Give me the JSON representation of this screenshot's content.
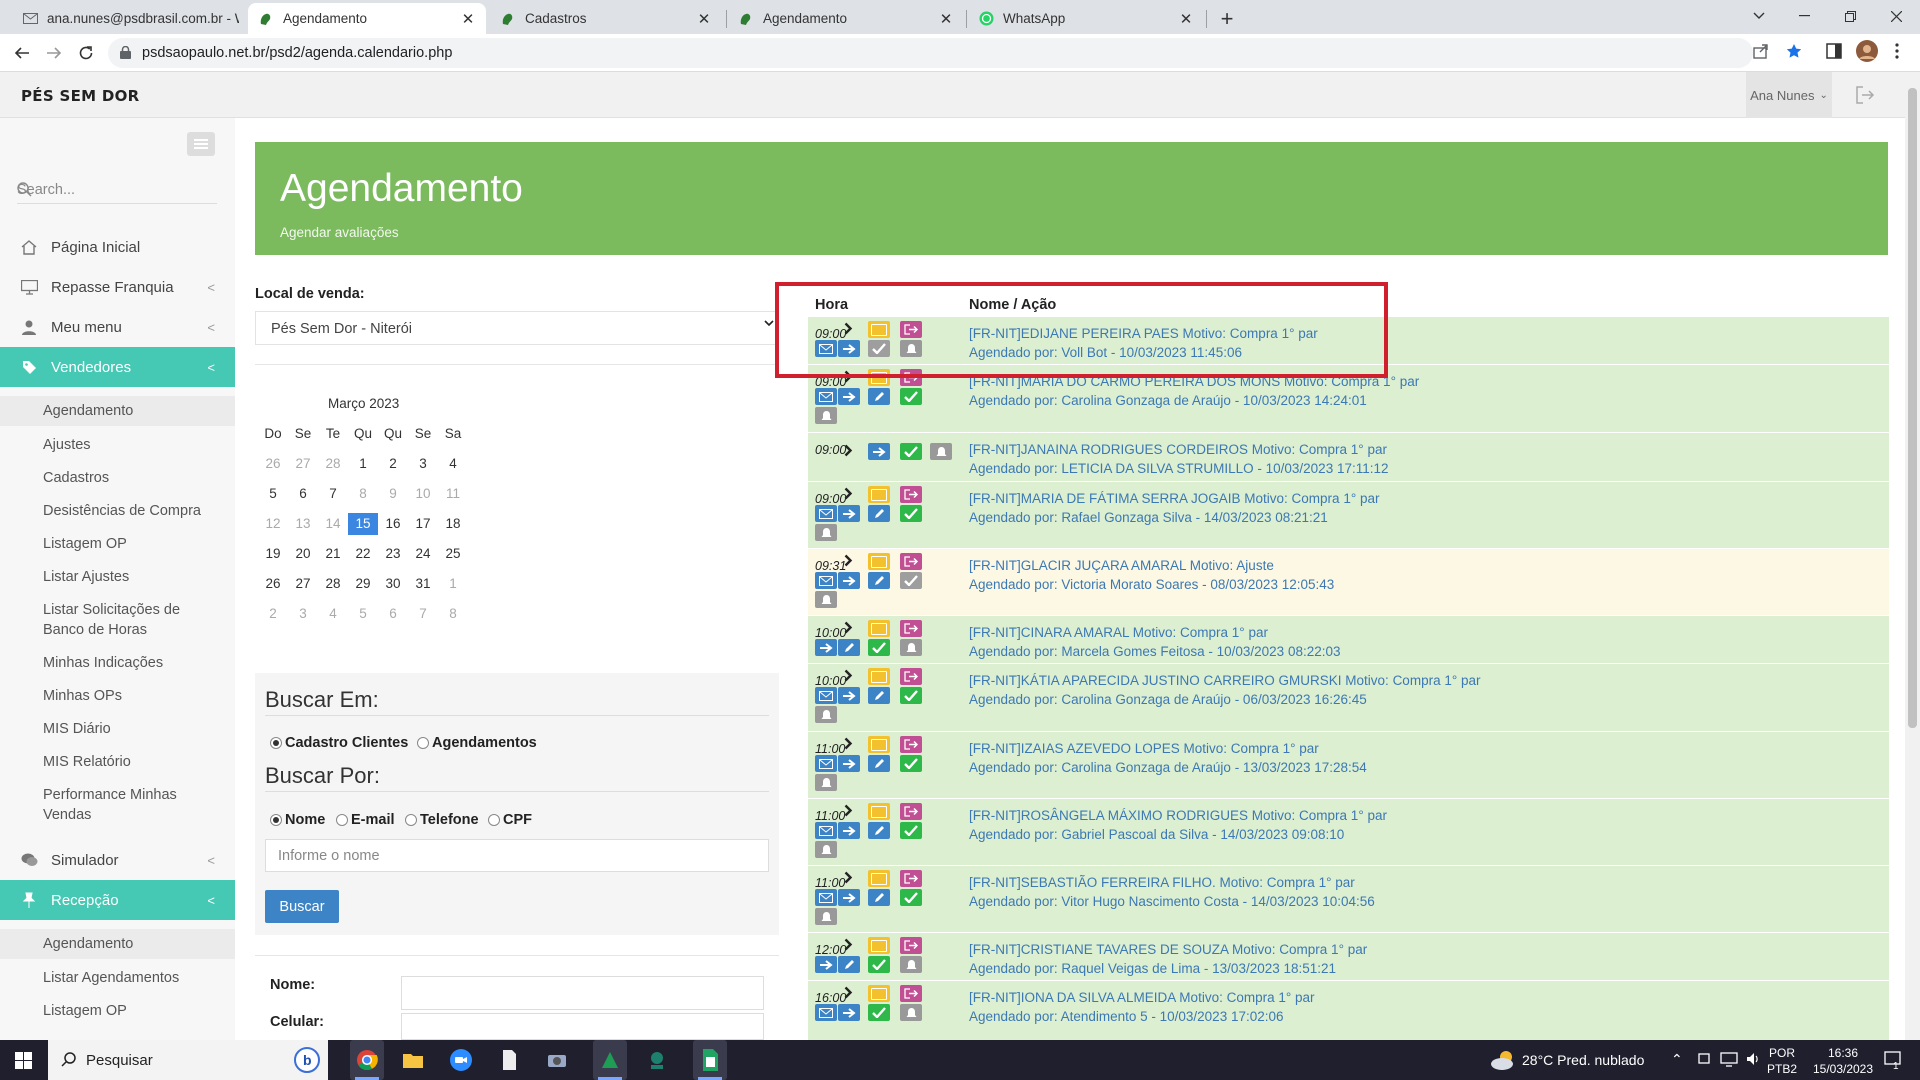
{
  "browser": {
    "tabs": [
      {
        "title": "ana.nunes@psdbrasil.com.br - W",
        "icon": "mail-icon",
        "active": false
      },
      {
        "title": "Agendamento",
        "icon": "foot-logo-icon",
        "active": true
      },
      {
        "title": "Cadastros",
        "icon": "foot-logo-icon",
        "active": false
      },
      {
        "title": "Agendamento",
        "icon": "foot-logo-icon",
        "active": false
      },
      {
        "title": "WhatsApp",
        "icon": "whatsapp-icon",
        "active": false
      }
    ],
    "url": "psdsaopaulo.net.br/psd2/agenda.calendario.php"
  },
  "header": {
    "brand": "PÉS SEM DOR",
    "user": "Ana Nunes"
  },
  "sidebar": {
    "search_placeholder": "Search...",
    "items": [
      {
        "label": "Página Inicial",
        "icon": "home-icon"
      },
      {
        "label": "Repasse Franquia",
        "icon": "monitor-icon"
      },
      {
        "label": "Meu menu",
        "icon": "user-icon"
      },
      {
        "label": "Vendedores",
        "icon": "tag-icon"
      }
    ],
    "vendedores_sub": [
      "Agendamento",
      "Ajustes",
      "Cadastros",
      "Desistências de Compra",
      "Listagem OP",
      "Listar Ajustes",
      "Listar Solicitações de",
      "Banco de Horas",
      "Minhas Indicações",
      "Minhas OPs",
      "MIS Diário",
      "MIS Relatório",
      "Performance Minhas",
      "Vendas"
    ],
    "simulador": "Simulador",
    "recepcao": "Recepção",
    "recepcao_sub": [
      "Agendamento",
      "Listar Agendamentos",
      "Listagem OP"
    ]
  },
  "hero": {
    "title": "Agendamento",
    "subtitle": "Agendar avaliações"
  },
  "local": {
    "label": "Local de venda:",
    "value": "Pés Sem Dor - Niterói"
  },
  "calendar": {
    "month": "Março 2023",
    "weekdays": [
      "Do",
      "Se",
      "Te",
      "Qu",
      "Qu",
      "Se",
      "Sa"
    ],
    "weeks": [
      [
        "26",
        "27",
        "28",
        "1",
        "2",
        "3",
        "4"
      ],
      [
        "5",
        "6",
        "7",
        "8",
        "9",
        "10",
        "11"
      ],
      [
        "12",
        "13",
        "14",
        "15",
        "16",
        "17",
        "18"
      ],
      [
        "19",
        "20",
        "21",
        "22",
        "23",
        "24",
        "25"
      ],
      [
        "26",
        "27",
        "28",
        "29",
        "30",
        "31",
        "1"
      ],
      [
        "2",
        "3",
        "4",
        "5",
        "6",
        "7",
        "8"
      ]
    ],
    "today": "15"
  },
  "search_panel": {
    "buscar_em": "Buscar Em:",
    "em_options": [
      "Cadastro Clientes",
      "Agendamentos"
    ],
    "buscar_por": "Buscar Por:",
    "por_options": [
      "Nome",
      "E-mail",
      "Telefone",
      "CPF"
    ],
    "input_placeholder": "Informe o nome",
    "button": "Buscar"
  },
  "form": {
    "nome_label": "Nome:",
    "celular_label": "Celular:"
  },
  "schedule": {
    "col_hora": "Hora",
    "col_nome": "Nome / Ação",
    "rows": [
      {
        "time": "09:00",
        "line1": "[FR-NIT]EDIJANE PEREIRA PAES Motivo: Compra 1° par",
        "line2": "Agendado por: Voll Bot - 10/03/2023 11:45:06",
        "bg": "#dcefd0"
      },
      {
        "time": "09:00",
        "line1": "[FR-NIT]MARIA DO CARMO PEREIRA DOS MONS Motivo: Compra 1° par",
        "line2": "Agendado por: Carolina Gonzaga de Araújo - 10/03/2023 14:24:01",
        "bg": "#dcefd0"
      },
      {
        "time": "09:00",
        "line1": "[FR-NIT]JANAINA RODRIGUES CORDEIROS Motivo: Compra 1° par",
        "line2": "Agendado por: LETICIA DA SILVA STRUMILLO - 10/03/2023 17:11:12",
        "bg": "#dcefd0"
      },
      {
        "time": "09:00",
        "line1": "[FR-NIT]MARIA DE FÁTIMA SERRA JOGAIB Motivo: Compra 1° par",
        "line2": "Agendado por: Rafael Gonzaga Silva - 14/03/2023 08:21:21",
        "bg": "#dcefd0"
      },
      {
        "time": "09:31",
        "line1": "[FR-NIT]GLACIR JUÇARA AMARAL Motivo: Ajuste",
        "line2": "Agendado por: Victoria Morato Soares - 08/03/2023 12:05:43",
        "bg": "#fcf8e3"
      },
      {
        "time": "10:00",
        "line1": "[FR-NIT]CINARA AMARAL Motivo: Compra 1° par",
        "line2": "Agendado por: Marcela Gomes Feitosa - 10/03/2023 08:22:03",
        "bg": "#dcefd0"
      },
      {
        "time": "10:00",
        "line1": "[FR-NIT]KÁTIA APARECIDA JUSTINO CARREIRO GMURSKI Motivo: Compra 1° par",
        "line2": "Agendado por: Carolina Gonzaga de Araújo - 06/03/2023 16:26:45",
        "bg": "#dcefd0"
      },
      {
        "time": "11:00",
        "line1": "[FR-NIT]IZAIAS AZEVEDO LOPES Motivo: Compra 1° par",
        "line2": "Agendado por: Carolina Gonzaga de Araújo - 13/03/2023 17:28:54",
        "bg": "#dcefd0"
      },
      {
        "time": "11:00",
        "line1": "[FR-NIT]ROSÂNGELA MÁXIMO RODRIGUES Motivo: Compra 1° par",
        "line2": "Agendado por: Gabriel Pascoal da Silva - 14/03/2023 09:08:10",
        "bg": "#dcefd0"
      },
      {
        "time": "11:00",
        "line1": "[FR-NIT]SEBASTIÃO FERREIRA FILHO. Motivo: Compra 1° par",
        "line2": "Agendado por: Vitor Hugo Nascimento Costa - 14/03/2023 10:04:56",
        "bg": "#dcefd0"
      },
      {
        "time": "12:00",
        "line1": "[FR-NIT]CRISTIANE TAVARES DE SOUZA Motivo: Compra 1° par",
        "line2": "Agendado por: Raquel Veigas de Lima - 13/03/2023 18:51:21",
        "bg": "#dcefd0"
      },
      {
        "time": "16:00",
        "line1": "[FR-NIT]IONA DA SILVA ALMEIDA Motivo: Compra 1° par",
        "line2": "Agendado por: Atendimento 5 - 10/03/2023 17:02:06",
        "bg": "#dcefd0"
      }
    ]
  },
  "taskbar": {
    "search": "Pesquisar",
    "weather": "28°C  Pred. nublado",
    "lang1": "POR",
    "lang2": "PTB2",
    "time": "16:36",
    "date": "15/03/2023",
    "notif": "1"
  }
}
